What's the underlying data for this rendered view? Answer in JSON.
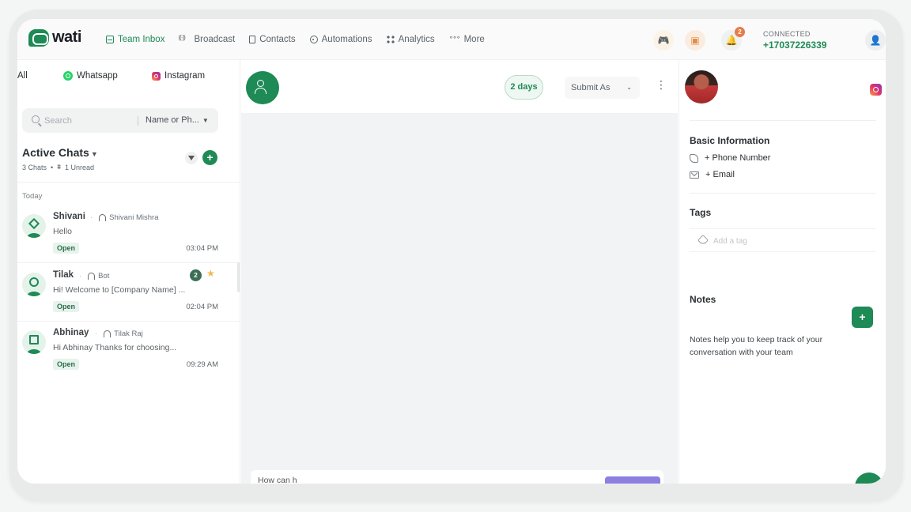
{
  "brand": {
    "name": "wati",
    "color": "#1e8a56"
  },
  "nav": {
    "items": [
      {
        "label": "Team Inbox",
        "icon": "inbox-icon",
        "active": true
      },
      {
        "label": "Broadcast",
        "icon": "broadcast-icon"
      },
      {
        "label": "Contacts",
        "icon": "contacts-icon"
      },
      {
        "label": "Automations",
        "icon": "automations-icon"
      },
      {
        "label": "Analytics",
        "icon": "analytics-icon"
      },
      {
        "label": "More",
        "icon": "more-icon"
      }
    ],
    "notifications_count": "2",
    "connection": {
      "status": "CONNECTED",
      "number": "+17037226339"
    }
  },
  "channels": {
    "all": "All",
    "whatsapp": "Whatsapp",
    "instagram": "Instagram"
  },
  "search": {
    "placeholder": "Search",
    "type": "Name or Ph..."
  },
  "active_chats": {
    "title": "Active Chats",
    "count": "3 Chats",
    "unread": "1 Unread",
    "section": "Today"
  },
  "chats": [
    {
      "name": "Shivani",
      "agent": "Shivani Mishra",
      "message": "Hello",
      "status": "Open",
      "time": "03:04 PM",
      "avatar": "diamond"
    },
    {
      "name": "Tilak",
      "agent": "Bot",
      "message": "Hi! Welcome to [Company Name] ...",
      "status": "Open",
      "time": "02:04 PM",
      "badge": "2",
      "starred": true,
      "avatar": "circle"
    },
    {
      "name": "Abhinay",
      "agent": "Tilak Raj",
      "message": "Hi Abhinay Thanks for choosing...",
      "status": "Open",
      "time": "09:29 AM",
      "avatar": "square"
    }
  ],
  "conversation": {
    "days": "2 days",
    "submit_as": "Submit As",
    "composer_text": "How can h"
  },
  "contact": {
    "basic_info": "Basic Information",
    "phone": "+ Phone Number",
    "email": "+ Email",
    "tags": "Tags",
    "tag_placeholder": "Add a tag",
    "notes": "Notes",
    "notes_help": "Notes help you to keep track of your conversation with your team"
  }
}
